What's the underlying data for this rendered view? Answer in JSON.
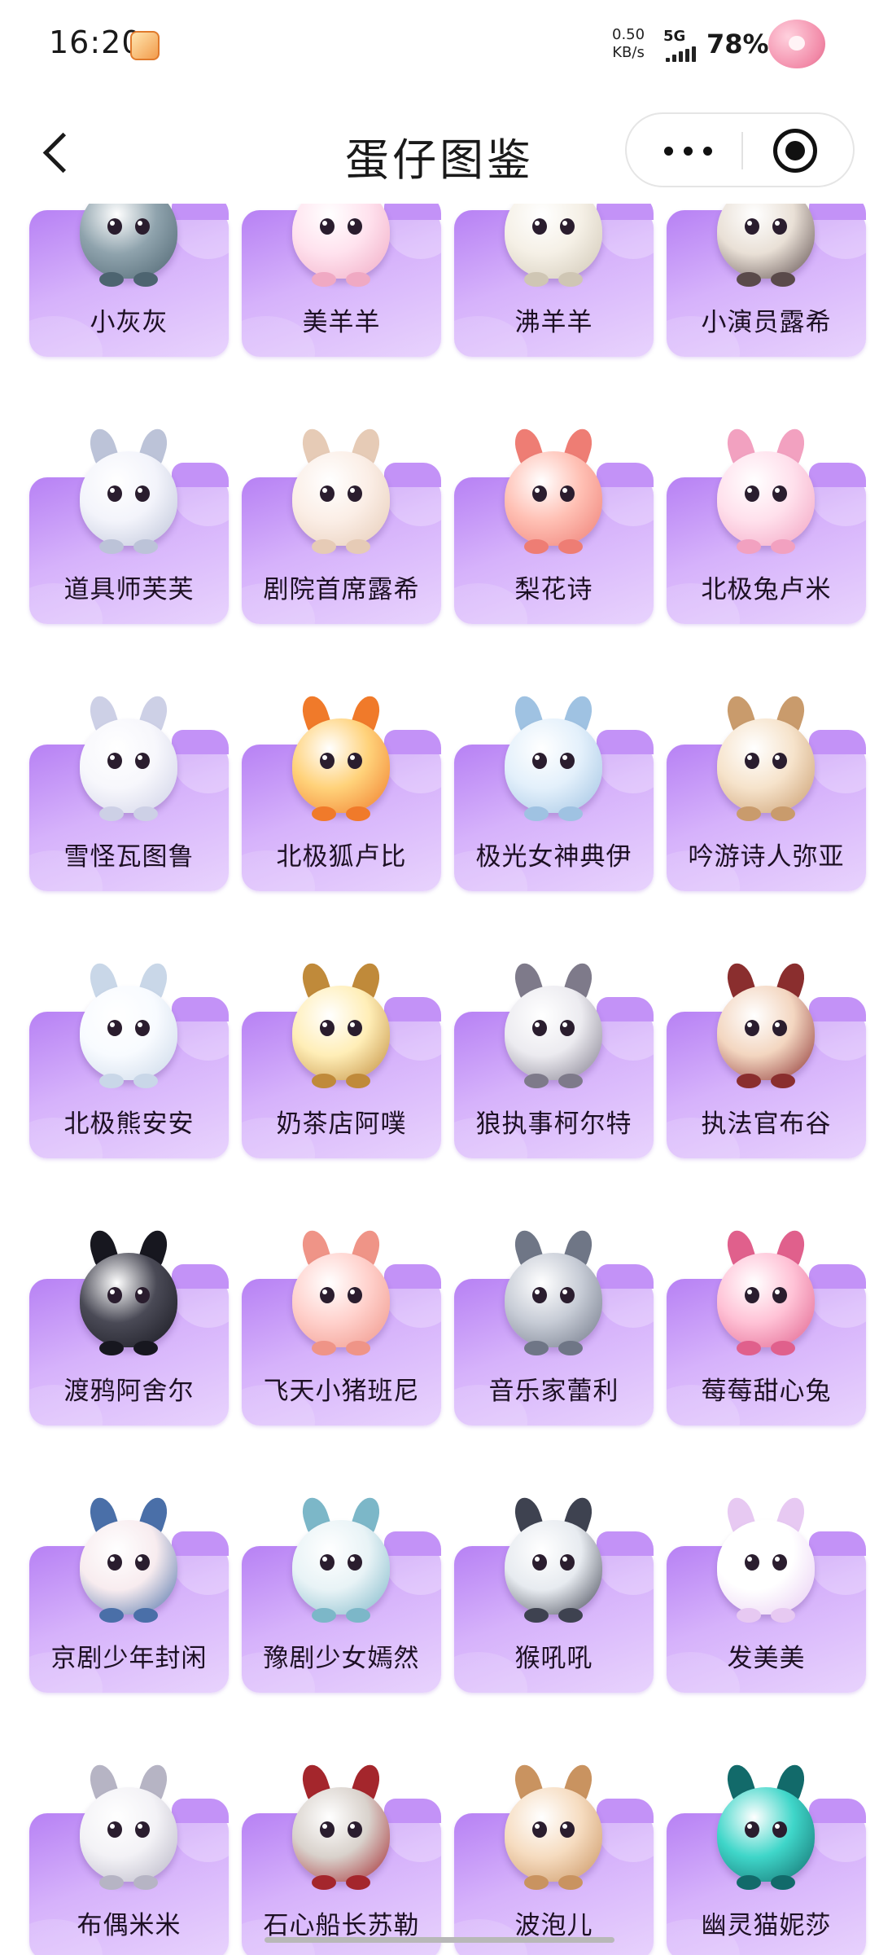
{
  "status_bar": {
    "time": "16:20",
    "net_speed_value": "0.50",
    "net_speed_unit": "KB/s",
    "network": "5G",
    "battery": "78%"
  },
  "nav": {
    "title": "蛋仔图鉴"
  },
  "colors": {
    "card_gradient_start": "#b781f4",
    "card_gradient_end": "#e8d3fd"
  },
  "characters": [
    {
      "name": "小灰灰",
      "c1": "#8fa3ad",
      "c2": "#4d6470"
    },
    {
      "name": "美羊羊",
      "c1": "#ffe2ee",
      "c2": "#f0a9c3"
    },
    {
      "name": "沸羊羊",
      "c1": "#f5f0e6",
      "c2": "#cfc6b4"
    },
    {
      "name": "小演员露希",
      "c1": "#e9e0d6",
      "c2": "#5a4a4a"
    },
    {
      "name": "道具师芙芙",
      "c1": "#f3f4fb",
      "c2": "#bcc3d8"
    },
    {
      "name": "剧院首席露希",
      "c1": "#fbeee6",
      "c2": "#e6cbb6"
    },
    {
      "name": "梨花诗",
      "c1": "#ffc0b4",
      "c2": "#ee7d74"
    },
    {
      "name": "北极兔卢米",
      "c1": "#ffe0ec",
      "c2": "#f2a1c0"
    },
    {
      "name": "雪怪瓦图鲁",
      "c1": "#f7f7fc",
      "c2": "#cdd0e6"
    },
    {
      "name": "北极狐卢比",
      "c1": "#ffd27a",
      "c2": "#f07a2a"
    },
    {
      "name": "极光女神典伊",
      "c1": "#e3f0fb",
      "c2": "#9fc2e2"
    },
    {
      "name": "吟游诗人弥亚",
      "c1": "#f6e3cb",
      "c2": "#c99b6c"
    },
    {
      "name": "北极熊安安",
      "c1": "#f8fbff",
      "c2": "#c9d7e8"
    },
    {
      "name": "奶茶店阿噗",
      "c1": "#ffeeb7",
      "c2": "#c08a3a"
    },
    {
      "name": "狼执事柯尔特",
      "c1": "#ecebf0",
      "c2": "#7e7a8a"
    },
    {
      "name": "执法官布谷",
      "c1": "#f3d6c0",
      "c2": "#8a2e2e"
    },
    {
      "name": "渡鸦阿舍尔",
      "c1": "#4a4a56",
      "c2": "#17171f"
    },
    {
      "name": "飞天小猪班尼",
      "c1": "#ffd1cc",
      "c2": "#ef9487"
    },
    {
      "name": "音乐家蕾利",
      "c1": "#c7ccd6",
      "c2": "#6f7686"
    },
    {
      "name": "莓莓甜心兔",
      "c1": "#ffc2d6",
      "c2": "#e0608c"
    },
    {
      "name": "京剧少年封闲",
      "c1": "#f8ecef",
      "c2": "#4a6fa8"
    },
    {
      "name": "豫剧少女嫣然",
      "c1": "#e8f3f6",
      "c2": "#7cb7c8"
    },
    {
      "name": "猴吼吼",
      "c1": "#e7ebf0",
      "c2": "#3e4250"
    },
    {
      "name": "发美美",
      "c1": "#ffffff",
      "c2": "#e7c9f2"
    },
    {
      "name": "布偶米米",
      "c1": "#f3f2f6",
      "c2": "#b6b4c4"
    },
    {
      "name": "石心船长苏勒",
      "c1": "#d9d2cc",
      "c2": "#a4262c"
    },
    {
      "name": "波泡儿",
      "c1": "#f6dcc0",
      "c2": "#c99360"
    },
    {
      "name": "幽灵猫妮莎",
      "c1": "#3fd6c9",
      "c2": "#126a6a"
    }
  ]
}
